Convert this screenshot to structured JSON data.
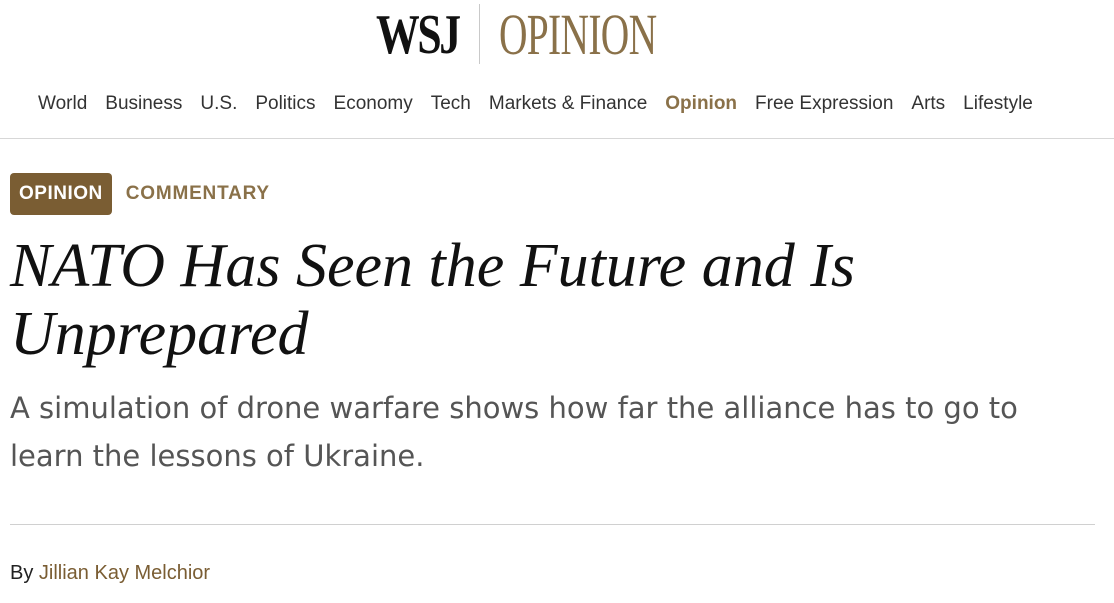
{
  "masthead": {
    "brand": "WSJ",
    "section": "OPINION"
  },
  "nav": {
    "items": [
      {
        "label": "World"
      },
      {
        "label": "Business"
      },
      {
        "label": "U.S."
      },
      {
        "label": "Politics"
      },
      {
        "label": "Economy"
      },
      {
        "label": "Tech"
      },
      {
        "label": "Markets & Finance"
      },
      {
        "label": "Opinion",
        "active": true
      },
      {
        "label": "Free Expression"
      },
      {
        "label": "Arts"
      },
      {
        "label": "Lifestyle"
      }
    ]
  },
  "article": {
    "flag": "OPINION",
    "category": "COMMENTARY",
    "headline": "NATO Has Seen the Future and Is Unprepared",
    "dek": "A simulation of drone warfare shows how far the alliance has to go to learn the lessons of Ukraine.",
    "byline_prefix": "By",
    "author": "Jillian Kay Melchior"
  },
  "colors": {
    "accent": "#8a7149",
    "badge": "#7a5d33"
  }
}
